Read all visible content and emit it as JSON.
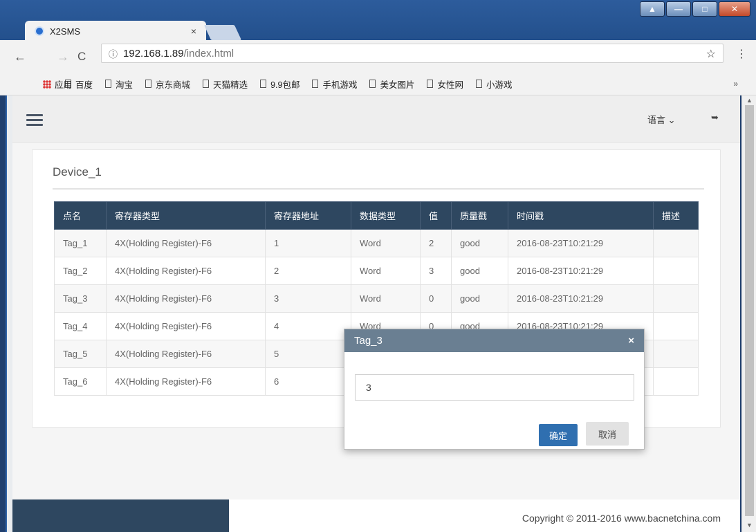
{
  "browser": {
    "tab_title": "X2SMS",
    "tab_close": "×",
    "url_host": "192.168.1.89",
    "url_path": "/index.html",
    "bookmarks_apps": "应用",
    "bookmarks": [
      "百度",
      "淘宝",
      "京东商城",
      "天猫精选",
      "9.9包邮",
      "手机游戏",
      "美女图片",
      "女性网",
      "小游戏"
    ],
    "more": "»"
  },
  "navbar": {
    "language_label": "语言",
    "language_chevron": "⌄"
  },
  "panel": {
    "title": "Device_1",
    "columns": [
      "点名",
      "寄存器类型",
      "寄存器地址",
      "数据类型",
      "值",
      "质量戳",
      "时间戳",
      "描述"
    ],
    "rows": [
      [
        "Tag_1",
        "4X(Holding Register)-F6",
        "1",
        "Word",
        "2",
        "good",
        "2016-08-23T10:21:29",
        ""
      ],
      [
        "Tag_2",
        "4X(Holding Register)-F6",
        "2",
        "Word",
        "3",
        "good",
        "2016-08-23T10:21:29",
        ""
      ],
      [
        "Tag_3",
        "4X(Holding Register)-F6",
        "3",
        "Word",
        "0",
        "good",
        "2016-08-23T10:21:29",
        ""
      ],
      [
        "Tag_4",
        "4X(Holding Register)-F6",
        "4",
        "Word",
        "0",
        "good",
        "2016-08-23T10:21:29",
        ""
      ],
      [
        "Tag_5",
        "4X(Holding Register)-F6",
        "5",
        "",
        "",
        "",
        "",
        ""
      ],
      [
        "Tag_6",
        "4X(Holding Register)-F6",
        "6",
        "",
        "",
        "",
        "",
        ""
      ]
    ]
  },
  "modal": {
    "title": "Tag_3",
    "close": "×",
    "input_value": "3",
    "ok_label": "确定",
    "cancel_label": "取消"
  },
  "footer": {
    "copyright": "Copyright © 2011-2016 www.bacnetchina.com"
  },
  "colors": {
    "header": "#2e4760",
    "modal_header": "#6a7f92",
    "primary": "#2f6fb0"
  }
}
